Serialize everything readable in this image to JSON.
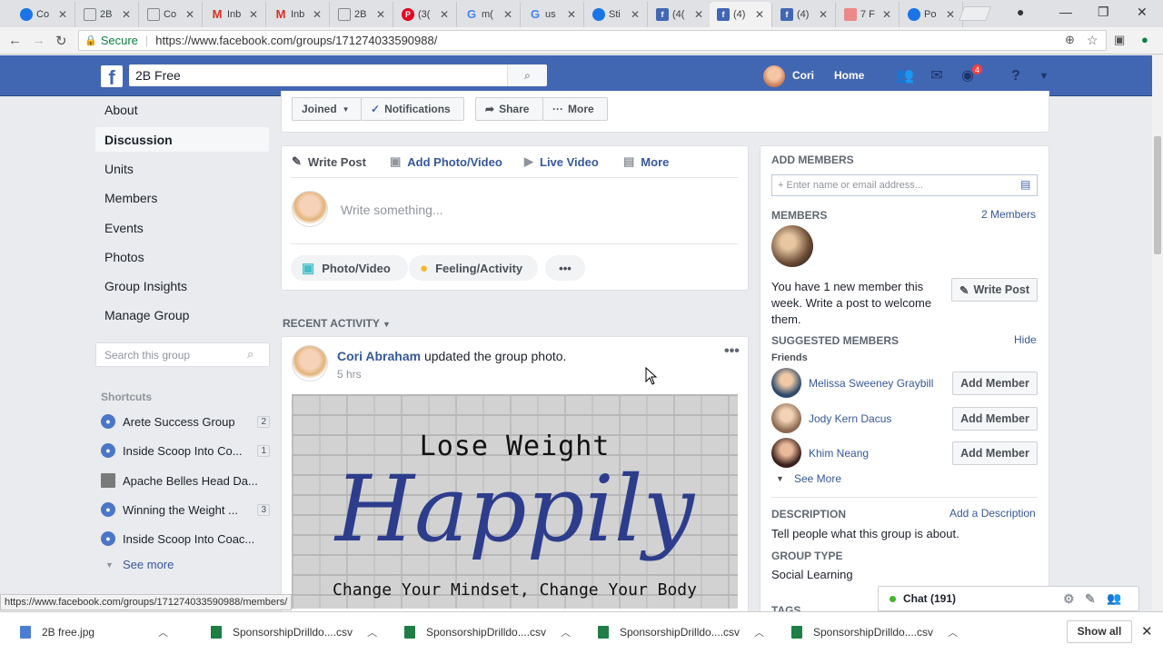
{
  "browser": {
    "tabs": [
      {
        "label": "Co",
        "icon": "chrome-icon",
        "color": "#1a73e8"
      },
      {
        "label": "2B",
        "icon": "doc-icon",
        "color": "#888888"
      },
      {
        "label": "Co",
        "icon": "doc-icon",
        "color": "#888888"
      },
      {
        "label": "Inb",
        "icon": "gmail-icon",
        "color": "#d93025"
      },
      {
        "label": "Inb",
        "icon": "gmail-icon",
        "color": "#d93025"
      },
      {
        "label": "2B",
        "icon": "doc-icon",
        "color": "#888888"
      },
      {
        "label": "(3(",
        "icon": "pinterest-icon",
        "color": "#e60023"
      },
      {
        "label": "m(",
        "icon": "google-icon",
        "color": "#4285f4"
      },
      {
        "label": "us",
        "icon": "google-icon",
        "color": "#4285f4"
      },
      {
        "label": "Sti",
        "icon": "chrome-icon",
        "color": "#1a73e8"
      },
      {
        "label": "(4(",
        "icon": "facebook-icon",
        "color": "#4267b2"
      },
      {
        "label": "(4)",
        "icon": "facebook-icon",
        "color": "#4267b2"
      },
      {
        "label": "(4)",
        "icon": "facebook-icon",
        "color": "#4267b2"
      },
      {
        "label": "7 F",
        "icon": "app-icon",
        "color": "#e88"
      },
      {
        "label": "Po",
        "icon": "chrome-icon",
        "color": "#1a73e8"
      }
    ],
    "secure_label": "Secure",
    "url": "https://www.facebook.com/groups/171274033590988/",
    "status_url": "https://www.facebook.com/groups/171274033590988/members/"
  },
  "fb": {
    "search_value": "2B Free",
    "user_name": "Cori",
    "home_label": "Home",
    "notif_count": "4",
    "brand_color": "#4267b2"
  },
  "left_nav": {
    "items": [
      "About",
      "Discussion",
      "Units",
      "Members",
      "Events",
      "Photos",
      "Group Insights",
      "Manage Group"
    ],
    "search_placeholder": "Search this group",
    "shortcuts_title": "Shortcuts",
    "shortcuts": [
      {
        "name": "Arete Success Group",
        "count": "2"
      },
      {
        "name": "Inside Scoop Into Co...",
        "count": "1"
      },
      {
        "name": "Apache Belles Head Da...",
        "count": ""
      },
      {
        "name": "Winning the Weight ...",
        "count": "3"
      },
      {
        "name": "Inside Scoop Into Coac...",
        "count": ""
      }
    ],
    "see_more": "See more"
  },
  "group_actions": {
    "joined": "Joined",
    "notifications": "Notifications",
    "share": "Share",
    "more": "More"
  },
  "composer": {
    "tabs": [
      "Write Post",
      "Add Photo/Video",
      "Live Video",
      "More"
    ],
    "placeholder": "Write something...",
    "photo_video": "Photo/Video",
    "feeling": "Feeling/Activity"
  },
  "feed": {
    "recent_label": "RECENT ACTIVITY",
    "post": {
      "author": "Cori Abraham",
      "action": " updated the group photo.",
      "time": "5 hrs",
      "image_line1": "Lose Weight",
      "image_line2": "Happily",
      "image_line3": "Change Your Mindset, Change Your Body"
    }
  },
  "right": {
    "add_members_title": "ADD MEMBERS",
    "add_members_placeholder": "+ Enter name or email address...",
    "members_title": "MEMBERS",
    "members_count": "2 Members",
    "new_member_text": "You have 1 new member this week. Write a post to welcome them.",
    "write_post": "Write Post",
    "suggested_title": "SUGGESTED MEMBERS",
    "hide": "Hide",
    "friends_label": "Friends",
    "friends": [
      {
        "name": "Melissa Sweeney Graybill",
        "button": "Add Member"
      },
      {
        "name": "Jody Kern Dacus",
        "button": "Add Member"
      },
      {
        "name": "Khim Neang",
        "button": "Add Member"
      }
    ],
    "see_more": "See More",
    "description_title": "DESCRIPTION",
    "add_description": "Add a Description",
    "description_text": "Tell people what this group is about.",
    "group_type_title": "GROUP TYPE",
    "group_type": "Social Learning",
    "tags_title": "TAGS"
  },
  "chat": {
    "label": "Chat (191)"
  },
  "downloads": {
    "items": [
      "2B free.jpg",
      "SponsorshipDrilldo....csv",
      "SponsorshipDrilldo....csv",
      "SponsorshipDrilldo....csv",
      "SponsorshipDrilldo....csv"
    ],
    "show_all": "Show all"
  }
}
